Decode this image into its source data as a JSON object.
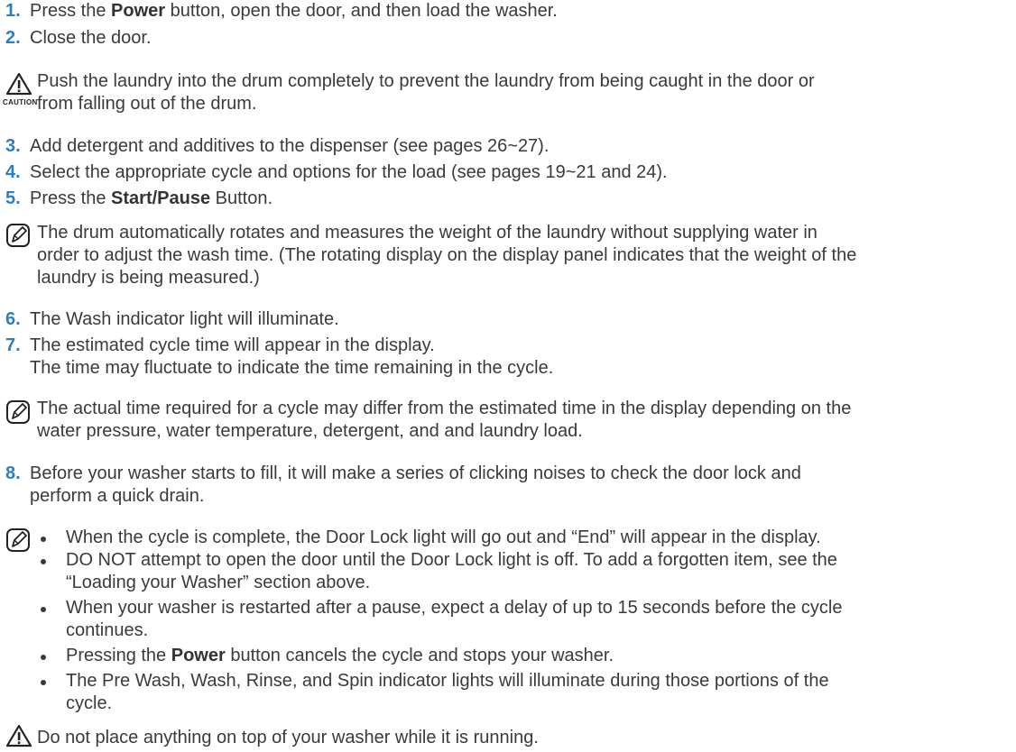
{
  "steps": {
    "s1": {
      "num": "1.",
      "pre": "Press the ",
      "bold": "Power",
      "post": " button, open the door, and then load the washer."
    },
    "s2": {
      "num": "2.",
      "text": "Close the door."
    },
    "caution1": {
      "label": "CAUTION",
      "line1": "Push the laundry into the drum completely to prevent the laundry from being caught in the door or",
      "line2": "from falling out of the drum."
    },
    "s3": {
      "num": "3.",
      "text": "Add detergent and additives to the dispenser (see pages 26~27)."
    },
    "s4": {
      "num": "4.",
      "text": "Select the appropriate cycle and options for the load (see pages 19~21 and 24)."
    },
    "s5": {
      "num": "5.",
      "pre": "Press the ",
      "bold": "Start/Pause",
      "post": " Button."
    },
    "note1": {
      "line1": "The drum automatically rotates and measures the weight of the laundry without supplying water in",
      "line2": "order to adjust the wash time. (The rotating display on the display panel indicates that the weight of the",
      "line3": "laundry is being measured.)"
    },
    "s6": {
      "num": "6.",
      "text": "The Wash indicator light will illuminate."
    },
    "s7": {
      "num": "7.",
      "line1": "The estimated cycle time will appear in the display.",
      "line2": "The time may fluctuate to indicate the time remaining in the cycle."
    },
    "note2": {
      "line1": "The actual time required for a cycle may differ from the estimated time in the display depending on the",
      "line2": "water pressure, water temperature, detergent, and and laundry load."
    },
    "s8": {
      "num": "8.",
      "line1": "Before your washer starts to fill, it will make a series of clicking noises to check the door lock and",
      "line2": "perform a quick drain."
    },
    "note3": {
      "b1": "When the cycle is complete, the Door Lock light will go out and “End” will appear in the display.",
      "b2l1": "DO NOT attempt to open the door until the Door Lock light is off. To add a forgotten item, see the",
      "b2l2": "“Loading your Washer” section above.",
      "b3l1": "When your washer is restarted after a pause, expect a delay of up to 15 seconds before the cycle",
      "b3l2": "continues.",
      "b4pre": "Pressing the ",
      "b4bold": "Power",
      "b4post": " button cancels the cycle and stops your washer.",
      "b5l1": "The Pre Wash, Wash, Rinse, and Spin indicator lights will illuminate during those portions of the",
      "b5l2": "cycle."
    },
    "warning": {
      "text": "Do not place anything on top of your washer while it is running."
    }
  },
  "colors": {
    "step_number": "#2a7fc4",
    "text": "#3a3a3a"
  },
  "icons": [
    "warning-triangle-icon",
    "note-pencil-icon"
  ]
}
